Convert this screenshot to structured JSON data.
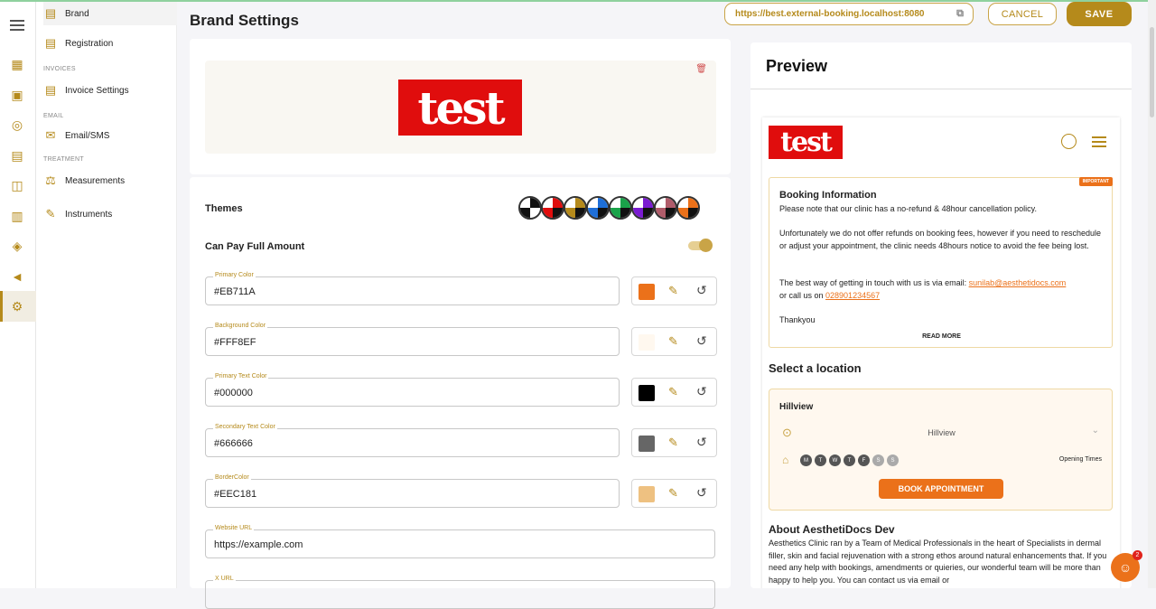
{
  "header": {
    "title": "Brand Settings",
    "url": "https://best.external-booking.localhost:8080",
    "cancel_label": "CANCEL",
    "save_label": "SAVE"
  },
  "subnav": {
    "items": [
      {
        "label": "Brand",
        "icon": "document-icon"
      },
      {
        "label": "Registration",
        "icon": "document-icon"
      },
      {
        "label": "Invoice Settings",
        "icon": "document-icon"
      },
      {
        "label": "Email/SMS",
        "icon": "envelope-icon"
      },
      {
        "label": "Measurements",
        "icon": "scale-icon"
      },
      {
        "label": "Instruments",
        "icon": "syringe-icon"
      }
    ],
    "captions": [
      "INVOICES",
      "EMAIL",
      "TREATMENT"
    ]
  },
  "brand": {
    "logo_text": "test",
    "themes_label": "Themes",
    "can_pay_label": "Can Pay Full Amount",
    "can_pay_enabled": true,
    "themes": [
      [
        "#ffffff",
        "#111111",
        "#111111",
        "#ffffff"
      ],
      [
        "#ffffff",
        "#e00d0d",
        "#e00d0d",
        "#111111"
      ],
      [
        "#ffffff",
        "#b58a1b",
        "#b58a1b",
        "#111111"
      ],
      [
        "#ffffff",
        "#1e6fd9",
        "#1e6fd9",
        "#111111"
      ],
      [
        "#ffffff",
        "#1aa34a",
        "#1aa34a",
        "#111111"
      ],
      [
        "#ffffff",
        "#7a1bd1",
        "#7a1bd1",
        "#111111"
      ],
      [
        "#ffffff",
        "#b05c6a",
        "#b05c6a",
        "#111111"
      ],
      [
        "#ffffff",
        "#eb711a",
        "#eb711a",
        "#111111"
      ]
    ],
    "fields": [
      {
        "label": "Primary Color",
        "value": "#EB711A",
        "swatch": "#EB711A"
      },
      {
        "label": "Background Color",
        "value": "#FFF8EF",
        "swatch": "#FFF8EF"
      },
      {
        "label": "Primary Text Color",
        "value": "#000000",
        "swatch": "#000000"
      },
      {
        "label": "Secondary Text Color",
        "value": "#666666",
        "swatch": "#666666"
      },
      {
        "label": "BorderColor",
        "value": "#EEC181",
        "swatch": "#EEC181"
      }
    ],
    "website_label": "Website URL",
    "website_value": "https://example.com",
    "x_label": "X URL"
  },
  "preview": {
    "title": "Preview",
    "logo_text": "test",
    "badge": "IMPORTANT",
    "info_title": "Booking Information",
    "info_p1": "Please note that our clinic has a no-refund & 48hour cancellation policy.",
    "info_p2": "Unfortunately we do not offer refunds on booking fees, however if you need to reschedule or adjust your appointment, the clinic needs 48hours notice to avoid the fee being lost.",
    "info_p3_a": "The best way of getting in touch with us is via email: ",
    "info_email": "sunilab@aesthetidocs.com",
    "info_p3_b": "or call us on ",
    "info_phone": "028901234567",
    "info_p4": "Thankyou",
    "read_more": "READ MORE",
    "select_location": "Select a location",
    "location_name": "Hillview",
    "location_dropdown": "Hillview",
    "days": [
      "M",
      "T",
      "W",
      "T",
      "F",
      "S",
      "S"
    ],
    "opening_times": "Opening Times",
    "book_label": "BOOK APPOINTMENT",
    "about_title": "About AesthetiDocs Dev",
    "about_text": "Aesthetics Clinic ran by a Team of Medical Professionals in the heart of Specialists in dermal filler, skin and facial rejuvenation with a strong ethos around natural enhancements that. If you need any help with bookings, amendments or quieries, our wonderful team will be more than happy to help you. You can contact us via email or"
  },
  "chat": {
    "count": "2"
  },
  "colors": {
    "accent": "#b58a1b",
    "primary": "#eb711a"
  }
}
